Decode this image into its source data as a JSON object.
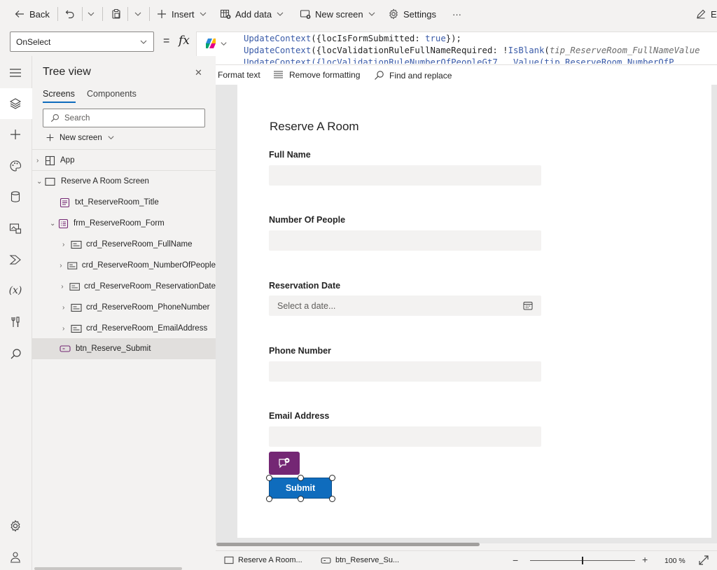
{
  "toolbar": {
    "back": "Back",
    "insert": "Insert",
    "add_data": "Add data",
    "new_screen": "New screen",
    "settings": "Settings",
    "more": "···",
    "edit_partial": "E"
  },
  "formula_bar": {
    "property": "OnSelect",
    "equals": "=",
    "fx": "fx",
    "line1_fn": "UpdateContext",
    "line1_rest": "({locIsFormSubmitted: ",
    "line1_kw": "true",
    "line1_end": "});",
    "line2_fn": "UpdateContext",
    "line2_rest": "({locValidationRuleFullNameRequired: !",
    "line2_fn2": "IsBlank",
    "line2_paren": "(",
    "line2_it": "tip_ReserveRoom_FullNameValue",
    "line3_partial": "UpdateContext({locValidationRuleNumberOfPeopleGt7...Value(tip_ReserveRoom_NumberOfP",
    "format_text": "Format text",
    "remove_formatting": "Remove formatting",
    "find_replace": "Find and replace"
  },
  "tree": {
    "title": "Tree view",
    "tabs": [
      "Screens",
      "Components"
    ],
    "search_placeholder": "Search",
    "new_screen": "New screen",
    "items": [
      {
        "label": "App"
      },
      {
        "label": "Reserve A Room Screen"
      },
      {
        "label": "txt_ReserveRoom_Title"
      },
      {
        "label": "frm_ReserveRoom_Form"
      },
      {
        "label": "crd_ReserveRoom_FullName"
      },
      {
        "label": "crd_ReserveRoom_NumberOfPeople"
      },
      {
        "label": "crd_ReserveRoom_ReservationDate"
      },
      {
        "label": "crd_ReserveRoom_PhoneNumber"
      },
      {
        "label": "crd_ReserveRoom_EmailAddress"
      },
      {
        "label": "btn_Reserve_Submit"
      }
    ]
  },
  "canvas": {
    "title": "Reserve A Room",
    "fields": [
      {
        "label": "Full Name",
        "value": ""
      },
      {
        "label": "Number Of People",
        "value": ""
      },
      {
        "label": "Reservation Date",
        "placeholder": "Select a date..."
      },
      {
        "label": "Phone Number",
        "value": ""
      },
      {
        "label": "Email Address",
        "value": ""
      }
    ],
    "submit": "Submit"
  },
  "status_bar": {
    "screen_crumb": "Reserve A Room...",
    "control_crumb": "btn_Reserve_Su...",
    "zoom": "100 %",
    "zoom_fraction": 0.5
  },
  "colors": {
    "submit_button": "#0f6cbd",
    "comment_button": "#742774",
    "accent": "#0f6cbd"
  }
}
